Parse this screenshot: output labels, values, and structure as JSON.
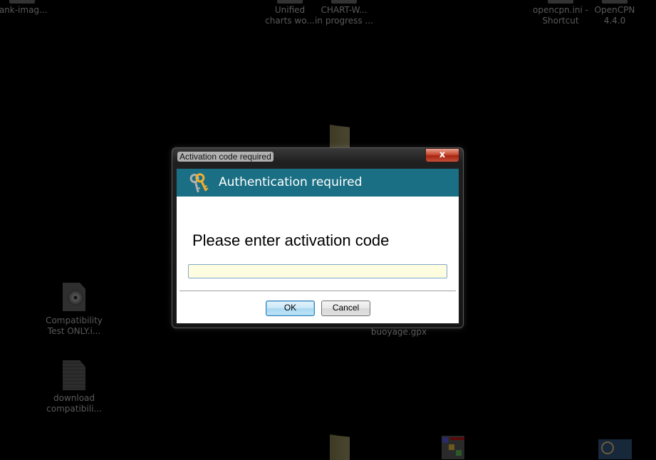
{
  "desktop": {
    "icons": [
      {
        "name": "blank-image",
        "label_line1": "lank-imag...",
        "label_line2": ""
      },
      {
        "name": "unified-charts",
        "label_line1": "Unified",
        "label_line2": "charts wo..."
      },
      {
        "name": "chart-work-in-progress",
        "label_line1": "CHART-W...",
        "label_line2": "in progress ..."
      },
      {
        "name": "opencpn-ini-shortcut",
        "label_line1": "opencpn.ini -",
        "label_line2": "Shortcut"
      },
      {
        "name": "opencpn-440",
        "label_line1": "OpenCPN",
        "label_line2": "4.4.0"
      },
      {
        "name": "compatibility-test",
        "label_line1": "Compatibility",
        "label_line2": "Test ONLY.i..."
      },
      {
        "name": "download-compatibility",
        "label_line1": "download",
        "label_line2": "compatibili..."
      },
      {
        "name": "buoyage-gpx",
        "label_line1": "buoyage.gpx",
        "label_line2": ""
      }
    ]
  },
  "dialog": {
    "window_title": "Activation code required",
    "close_label": "x",
    "banner_title": "Authentication required",
    "banner_icon": "keys-icon",
    "prompt": "Please enter activation code",
    "code_value": "",
    "ok_label": "OK",
    "cancel_label": "Cancel",
    "banner_color": "#1b6f84",
    "input_bg": "#fffde0"
  }
}
